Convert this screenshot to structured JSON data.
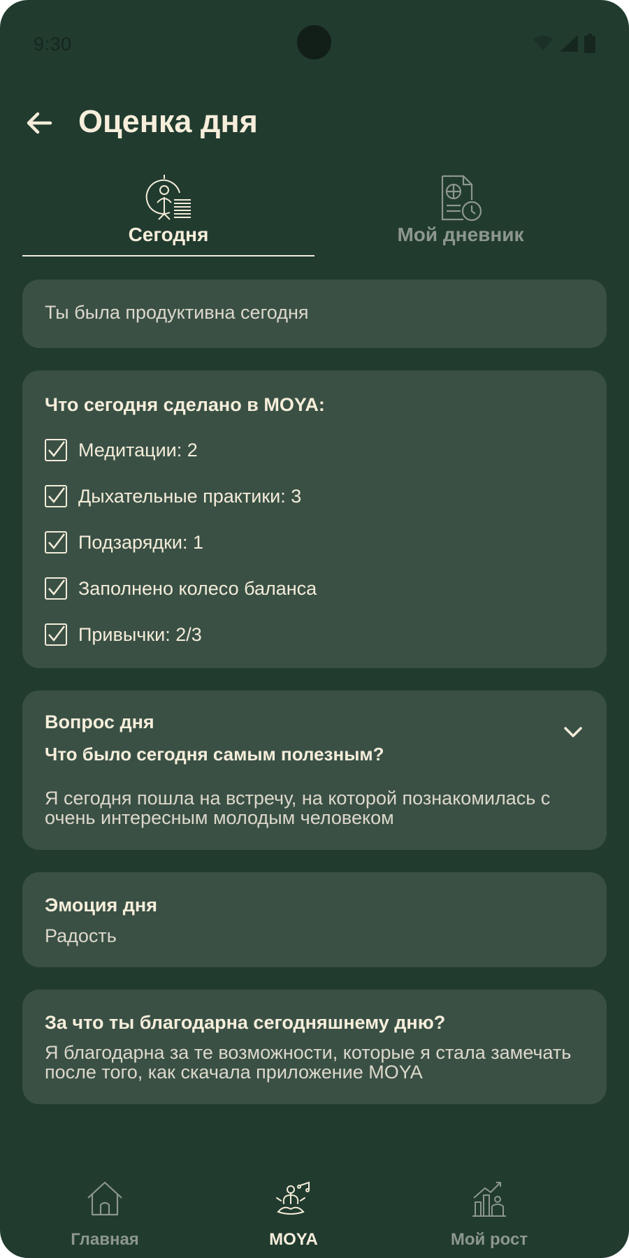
{
  "status_bar": {
    "time": "9:30"
  },
  "header": {
    "title": "Оценка дня"
  },
  "tabs": [
    {
      "label": "Сегодня",
      "icon": "person-chart-icon",
      "active": true
    },
    {
      "label": "Мой дневник",
      "icon": "diary-clock-icon",
      "active": false
    }
  ],
  "productivity": {
    "text": "Ты была продуктивна сегодня"
  },
  "done": {
    "heading": "Что сегодня сделано в MOYA:",
    "items": [
      {
        "label": "Медитации: 2",
        "checked": true
      },
      {
        "label": "Дыхательные практики: 3",
        "checked": true
      },
      {
        "label": "Подзарядки: 1",
        "checked": true
      },
      {
        "label": "Заполнено колесо баланса",
        "checked": true
      },
      {
        "label": "Привычки: 2/3",
        "checked": true
      }
    ]
  },
  "question": {
    "heading": "Вопрос дня",
    "question": "Что было сегодня самым полезным?",
    "answer": "Я сегодня пошла на встречу, на которой познакомилась с очень интересным молодым человеком"
  },
  "emotion": {
    "heading": "Эмоция дня",
    "value": "Радость"
  },
  "gratitude": {
    "heading": "За что ты благодарна сегодняшнему дню?",
    "text": "Я благодарна за те возможности, которые я стала замечать после того, как скачала приложение MOYA"
  },
  "bottom_nav": [
    {
      "label": "Главная",
      "icon": "home-icon",
      "active": false
    },
    {
      "label": "MOYA",
      "icon": "meditation-icon",
      "active": true
    },
    {
      "label": "Мой рост",
      "icon": "growth-icon",
      "active": false
    }
  ],
  "colors": {
    "background": "#213b2f",
    "card": "#3a5045",
    "text_primary": "#f4ecd9",
    "text_inactive": "#8d978f"
  }
}
